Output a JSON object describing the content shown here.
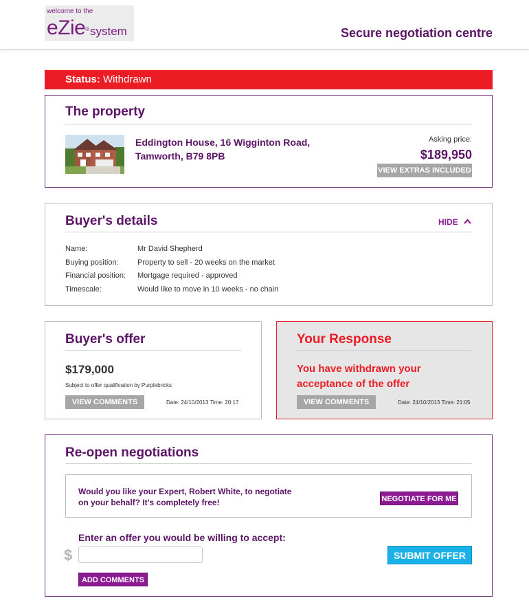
{
  "header": {
    "logo_small": "welcome to the",
    "logo_brand": "eZie",
    "logo_reg": "®",
    "logo_system": "system",
    "title": "Secure negotiation centre"
  },
  "status": {
    "label": "Status:",
    "value": "Withdrawn"
  },
  "property": {
    "heading": "The property",
    "address_line1": "Eddington House, 16 Wigginton Road,",
    "address_line2": "Tamworth, B79 8PB",
    "asking_label": "Asking price:",
    "asking_price": "$189,950",
    "extras_button": "VIEW EXTRAS INCLUDED"
  },
  "buyer": {
    "heading": "Buyer's details",
    "hide_label": "HIDE",
    "rows": [
      {
        "key": "Name:",
        "value": "Mr David Shepherd"
      },
      {
        "key": "Buying position:",
        "value": "Property to sell - 20 weeks on the market"
      },
      {
        "key": "Financial position:",
        "value": "Mortgage required - approved"
      },
      {
        "key": "Timescale:",
        "value": "Would like to move in 10 weeks - no chain"
      }
    ]
  },
  "offer": {
    "heading": "Buyer's offer",
    "amount": "$179,000",
    "subtext": "Subject to offer qualification by Purplebricks",
    "comments_button": "VIEW COMMENTS",
    "date": "Date: 24/10/2013 Time: 20:17"
  },
  "response": {
    "heading": "Your Response",
    "message_line1": "You have withdrawn your",
    "message_line2": "acceptance of the offer",
    "comments_button": "VIEW COMMENTS",
    "date": "Date: 24/10/2013 Time: 21:05"
  },
  "reopen": {
    "heading": "Re-open negotiations",
    "question_line1": "Would you like your Expert, Robert White, to negotiate",
    "question_line2": "on your behalf? It's completely free!",
    "negotiate_button": "NEGOTIATE FOR ME",
    "enter_label": "Enter an offer you would be willing to accept:",
    "currency_symbol": "$",
    "offer_value": "",
    "submit_button": "SUBMIT OFFER",
    "add_comments_button": "ADD COMMENTS"
  },
  "colors": {
    "brand_purple": "#5b1466",
    "button_purple": "#8b1a93",
    "status_red": "#ec1c24",
    "submit_blue": "#1ab0e8",
    "button_grey": "#a6a6a6"
  },
  "icons": {
    "hide": "chevron-up-icon",
    "property": "house-photo"
  }
}
